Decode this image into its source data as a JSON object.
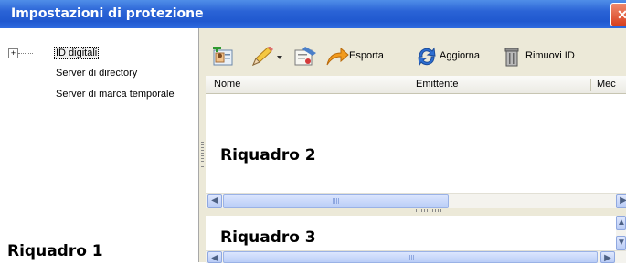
{
  "window": {
    "title": "Impostazioni di protezione"
  },
  "tree": {
    "expander": "+",
    "items": [
      {
        "label": "ID digitali"
      },
      {
        "label": "Server di directory"
      },
      {
        "label": "Server di marca temporale"
      }
    ]
  },
  "panels": {
    "panel1": "Riquadro 1",
    "panel2": "Riquadro 2",
    "panel3": "Riquadro 3"
  },
  "toolbar": {
    "add_icon": "add-id-icon",
    "edit_icon": "pencil-icon",
    "use_icon": "certificate-usage-icon",
    "export_label": "Esporta",
    "refresh_label": "Aggiorna",
    "remove_label": "Rimuovi ID"
  },
  "columns": [
    "Nome",
    "Emittente",
    "Mec"
  ],
  "colors": {
    "titlebar": "#2058cf",
    "toolbar_bg": "#ece9d8",
    "close": "#d8401f"
  }
}
